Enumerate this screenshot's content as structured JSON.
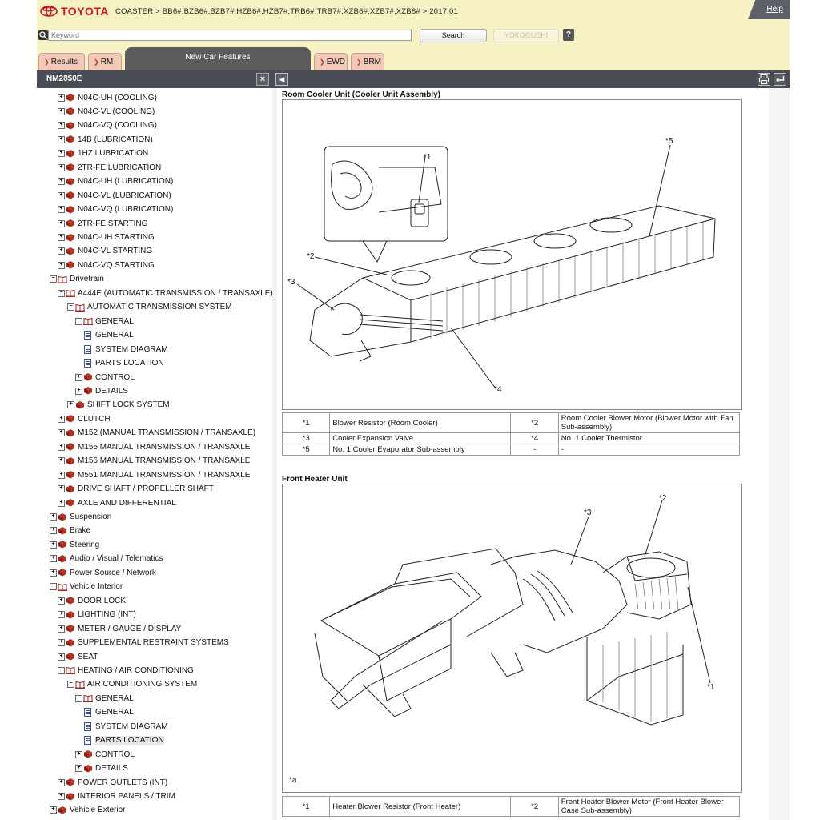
{
  "app": {
    "brand": "TOYOTA",
    "breadcrumb": "COASTER > BB6#,BZB6#,BZB7#,HZB6#,HZB7#,TRB6#,TRB7#,XZB6#,XZB7#,XZB8# > 2017.01",
    "help": "Help"
  },
  "search": {
    "placeholder": "Keyword",
    "button": "Search",
    "yokogushi": "YOKOGUSHI",
    "help_mark": "?"
  },
  "tabs": {
    "results": "Results",
    "rm": "RM",
    "ncf": "New Car Features",
    "ewd": "EWD",
    "brm": "BRM"
  },
  "panel": {
    "title": "NM2850E",
    "close": "×",
    "collapse": "◀"
  },
  "tree": [
    {
      "label": "N04C-UH (COOLING)",
      "level": 2,
      "type": "book-closed",
      "exp": "+"
    },
    {
      "label": "N04C-VL (COOLING)",
      "level": 2,
      "type": "book-closed",
      "exp": "+"
    },
    {
      "label": "N04C-VQ (COOLING)",
      "level": 2,
      "type": "book-closed",
      "exp": "+"
    },
    {
      "label": "14B (LUBRICATION)",
      "level": 2,
      "type": "book-closed",
      "exp": "+"
    },
    {
      "label": "1HZ LUBRICATION",
      "level": 2,
      "type": "book-closed",
      "exp": "+"
    },
    {
      "label": "2TR-FE LUBRICATION",
      "level": 2,
      "type": "book-closed",
      "exp": "+"
    },
    {
      "label": "N04C-UH (LUBRICATION)",
      "level": 2,
      "type": "book-closed",
      "exp": "+"
    },
    {
      "label": "N04C-VL (LUBRICATION)",
      "level": 2,
      "type": "book-closed",
      "exp": "+"
    },
    {
      "label": "N04C-VQ (LUBRICATION)",
      "level": 2,
      "type": "book-closed",
      "exp": "+"
    },
    {
      "label": "2TR-FE STARTING",
      "level": 2,
      "type": "book-closed",
      "exp": "+"
    },
    {
      "label": "N04C-UH STARTING",
      "level": 2,
      "type": "book-closed",
      "exp": "+"
    },
    {
      "label": "N04C-VL STARTING",
      "level": 2,
      "type": "book-closed",
      "exp": "+"
    },
    {
      "label": "N04C-VQ STARTING",
      "level": 2,
      "type": "book-closed",
      "exp": "+"
    },
    {
      "label": "Drivetrain",
      "level": 1,
      "type": "book-open",
      "exp": "-"
    },
    {
      "label": "A444E (AUTOMATIC TRANSMISSION / TRANSAXLE)",
      "level": 2,
      "type": "book-open",
      "exp": "-"
    },
    {
      "label": "AUTOMATIC TRANSMISSION SYSTEM",
      "level": 3,
      "type": "book-open",
      "exp": "-"
    },
    {
      "label": "GENERAL",
      "level": 4,
      "type": "book-open",
      "exp": "-"
    },
    {
      "label": "GENERAL",
      "level": 5,
      "type": "doc",
      "exp": ""
    },
    {
      "label": "SYSTEM DIAGRAM",
      "level": 5,
      "type": "doc",
      "exp": ""
    },
    {
      "label": "PARTS LOCATION",
      "level": 5,
      "type": "doc",
      "exp": ""
    },
    {
      "label": "CONTROL",
      "level": 4,
      "type": "book-closed",
      "exp": "+"
    },
    {
      "label": "DETAILS",
      "level": 4,
      "type": "book-closed",
      "exp": "+"
    },
    {
      "label": "SHIFT LOCK SYSTEM",
      "level": 3,
      "type": "book-closed",
      "exp": "+"
    },
    {
      "label": "CLUTCH",
      "level": 2,
      "type": "book-closed",
      "exp": "+"
    },
    {
      "label": "M152 (MANUAL TRANSMISSION / TRANSAXLE)",
      "level": 2,
      "type": "book-closed",
      "exp": "+"
    },
    {
      "label": "M155 MANUAL TRANSMISSION / TRANSAXLE",
      "level": 2,
      "type": "book-closed",
      "exp": "+"
    },
    {
      "label": "M156 MANUAL TRANSMISSION / TRANSAXLE",
      "level": 2,
      "type": "book-closed",
      "exp": "+"
    },
    {
      "label": "M551 MANUAL TRANSMISSION / TRANSAXLE",
      "level": 2,
      "type": "book-closed",
      "exp": "+"
    },
    {
      "label": "DRIVE SHAFT / PROPELLER SHAFT",
      "level": 2,
      "type": "book-closed",
      "exp": "+"
    },
    {
      "label": "AXLE AND DIFFERENTIAL",
      "level": 2,
      "type": "book-closed",
      "exp": "+"
    },
    {
      "label": "Suspension",
      "level": 1,
      "type": "book-closed",
      "exp": "+"
    },
    {
      "label": "Brake",
      "level": 1,
      "type": "book-closed",
      "exp": "+"
    },
    {
      "label": "Steering",
      "level": 1,
      "type": "book-closed",
      "exp": "+"
    },
    {
      "label": "Audio / Visual / Telematics",
      "level": 1,
      "type": "book-closed",
      "exp": "+"
    },
    {
      "label": "Power Source / Network",
      "level": 1,
      "type": "book-closed",
      "exp": "+"
    },
    {
      "label": "Vehicle Interior",
      "level": 1,
      "type": "book-open",
      "exp": "-"
    },
    {
      "label": "DOOR LOCK",
      "level": 2,
      "type": "book-closed",
      "exp": "+"
    },
    {
      "label": "LIGHTING (INT)",
      "level": 2,
      "type": "book-closed",
      "exp": "+"
    },
    {
      "label": "METER / GAUGE / DISPLAY",
      "level": 2,
      "type": "book-closed",
      "exp": "+"
    },
    {
      "label": "SUPPLEMENTAL RESTRAINT SYSTEMS",
      "level": 2,
      "type": "book-closed",
      "exp": "+"
    },
    {
      "label": "SEAT",
      "level": 2,
      "type": "book-closed",
      "exp": "+"
    },
    {
      "label": "HEATING / AIR CONDITIONING",
      "level": 2,
      "type": "book-open",
      "exp": "-"
    },
    {
      "label": "AIR CONDITIONING SYSTEM",
      "level": 3,
      "type": "book-open",
      "exp": "-"
    },
    {
      "label": "GENERAL",
      "level": 4,
      "type": "book-open",
      "exp": "-"
    },
    {
      "label": "GENERAL",
      "level": 5,
      "type": "doc",
      "exp": ""
    },
    {
      "label": "SYSTEM DIAGRAM",
      "level": 5,
      "type": "doc",
      "exp": ""
    },
    {
      "label": "PARTS LOCATION",
      "level": 5,
      "type": "doc",
      "exp": "",
      "selected": true
    },
    {
      "label": "CONTROL",
      "level": 4,
      "type": "book-closed",
      "exp": "+"
    },
    {
      "label": "DETAILS",
      "level": 4,
      "type": "book-closed",
      "exp": "+"
    },
    {
      "label": "POWER OUTLETS (INT)",
      "level": 2,
      "type": "book-closed",
      "exp": "+"
    },
    {
      "label": "INTERIOR PANELS / TRIM",
      "level": 2,
      "type": "book-closed",
      "exp": "+"
    },
    {
      "label": "Vehicle Exterior",
      "level": 1,
      "type": "book-closed",
      "exp": "+"
    }
  ],
  "section1": {
    "title": "Room Cooler Unit (Cooler Unit Assembly)",
    "callouts": [
      "*1",
      "*2",
      "*3",
      "*4",
      "*5"
    ],
    "legend": [
      [
        "*1",
        "Blower Resistor (Room Cooler)",
        "*2",
        "Room Cooler Blower Motor (Blower Motor with Fan Sub-assembly)"
      ],
      [
        "*3",
        "Cooler Expansion Valve",
        "*4",
        "No. 1 Cooler Thermistor"
      ],
      [
        "*5",
        "No. 1 Cooler Evaporator Sub-assembly",
        "-",
        "-"
      ]
    ]
  },
  "section2": {
    "title": "Front Heater Unit",
    "callouts": [
      "*1",
      "*2",
      "*3"
    ],
    "note": "*a",
    "legend": [
      [
        "*1",
        "Heater Blower Resistor (Front Heater)",
        "*2",
        "Front Heater Blower Motor (Front Heater Blower Case Sub-assembly)"
      ]
    ]
  },
  "colors": {
    "header": "#4a4d55",
    "banner": "#f6f2c4",
    "brand_red": "#d0102a",
    "tab_pink": "#f2c9b8"
  }
}
